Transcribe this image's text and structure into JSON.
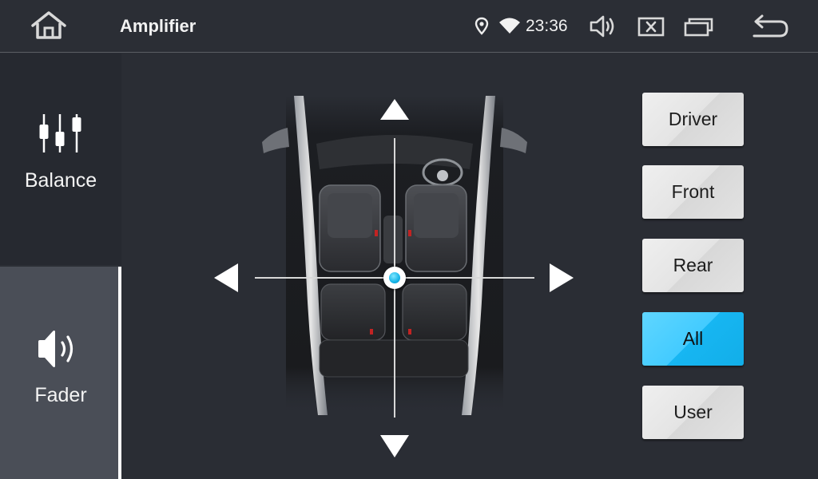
{
  "topbar": {
    "title": "Amplifier",
    "time": "23:36",
    "icons": [
      "home-icon",
      "location-icon",
      "wifi-icon",
      "volume-icon",
      "close-icon",
      "recent-apps-icon",
      "back-icon"
    ]
  },
  "sidebar": {
    "tabs": [
      {
        "label": "Balance",
        "icon": "equalizer-sliders-icon",
        "selected": false
      },
      {
        "label": "Fader",
        "icon": "speaker-icon",
        "selected": true
      }
    ]
  },
  "presets": [
    {
      "label": "Driver",
      "active": false
    },
    {
      "label": "Front",
      "active": false
    },
    {
      "label": "Rear",
      "active": false
    },
    {
      "label": "All",
      "active": true
    },
    {
      "label": "User",
      "active": false
    }
  ],
  "colors": {
    "accent": "#43cbff",
    "background": "#2a2d34",
    "selected_tab": "#4a4e57"
  }
}
